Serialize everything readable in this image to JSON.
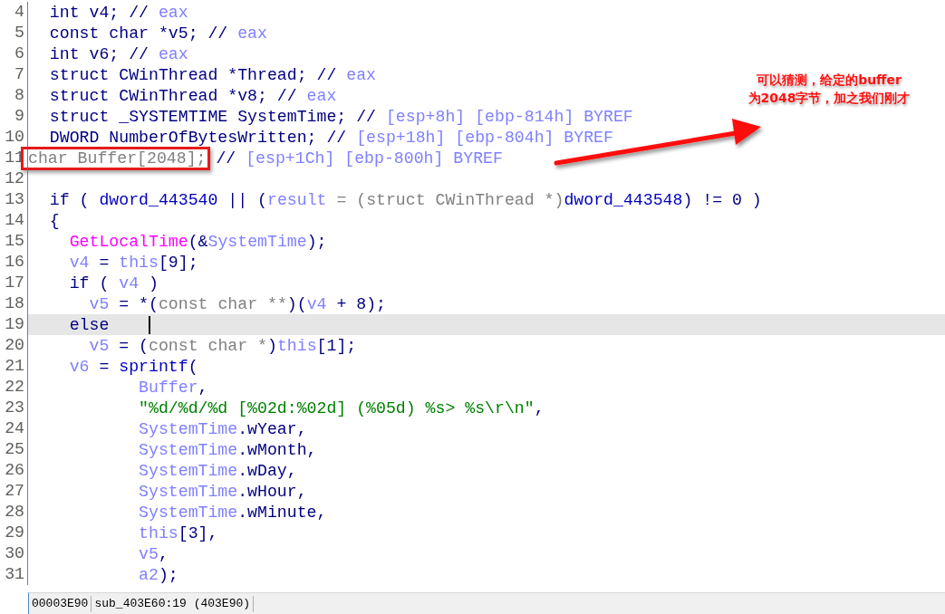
{
  "lines": [
    {
      "number": "4",
      "current": false,
      "parts": [
        {
          "text": "  int ",
          "kind": "k"
        },
        {
          "text": "v4",
          "kind": "k"
        },
        {
          "text": "; // ",
          "kind": "k"
        },
        {
          "text": "eax",
          "kind": "v"
        }
      ]
    },
    {
      "number": "5",
      "current": false,
      "parts": [
        {
          "text": "  const char *v5; // ",
          "kind": "k"
        },
        {
          "text": "eax",
          "kind": "v"
        }
      ]
    },
    {
      "number": "6",
      "current": false,
      "parts": [
        {
          "text": "  int v6; // ",
          "kind": "k"
        },
        {
          "text": "eax",
          "kind": "v"
        }
      ]
    },
    {
      "number": "7",
      "current": false,
      "parts": [
        {
          "text": "  struct CWinThread *Thread; // ",
          "kind": "k"
        },
        {
          "text": "eax",
          "kind": "v"
        }
      ]
    },
    {
      "number": "8",
      "current": false,
      "parts": [
        {
          "text": "  struct CWinThread *v8; // ",
          "kind": "k"
        },
        {
          "text": "eax",
          "kind": "v"
        }
      ]
    },
    {
      "number": "9",
      "current": false,
      "parts": [
        {
          "text": "  struct _SYSTEMTIME SystemTime; // ",
          "kind": "k"
        },
        {
          "text": "[esp+8h] [ebp-814h] BYREF",
          "kind": "v"
        }
      ]
    },
    {
      "number": "10",
      "current": false,
      "parts": [
        {
          "text": "  DWORD NumberOfBytesWritten; // ",
          "kind": "k"
        },
        {
          "text": "[esp+18h] [ebp-804h] BYREF",
          "kind": "v"
        }
      ]
    },
    {
      "number": "11",
      "current": false,
      "boxed": [
        {
          "text": "char Buffer[2048];",
          "kind": "g"
        }
      ],
      "parts": [
        {
          "text": " // ",
          "kind": "k"
        },
        {
          "text": "[esp+1Ch] [ebp-800h] BYREF",
          "kind": "v"
        }
      ]
    },
    {
      "number": "12",
      "current": false
    },
    {
      "number": "13",
      "current": false,
      "parts": [
        {
          "text": "  if ( ",
          "kind": "k"
        },
        {
          "text": "dword_443540",
          "kind": "b"
        },
        {
          "text": " || (",
          "kind": "k"
        },
        {
          "text": "result",
          "kind": "v"
        },
        {
          "text": " = (struct CWinThread *)",
          "kind": "g"
        },
        {
          "text": "dword_443548",
          "kind": "b"
        },
        {
          "text": ") != 0 )",
          "kind": "k"
        }
      ]
    },
    {
      "number": "14",
      "current": false,
      "parts": [
        {
          "text": "  {",
          "kind": "k"
        }
      ]
    },
    {
      "number": "15",
      "current": false,
      "parts": [
        {
          "text": "    GetLocalTime",
          "kind": "f"
        },
        {
          "text": "(&",
          "kind": "k"
        },
        {
          "text": "SystemTime",
          "kind": "v"
        },
        {
          "text": ");",
          "kind": "k"
        }
      ]
    },
    {
      "number": "16",
      "current": false,
      "parts": [
        {
          "text": "    v4",
          "kind": "v"
        },
        {
          "text": " = ",
          "kind": "k"
        },
        {
          "text": "this",
          "kind": "v"
        },
        {
          "text": "[9];",
          "kind": "k"
        }
      ]
    },
    {
      "number": "17",
      "current": false,
      "parts": [
        {
          "text": "    if ( ",
          "kind": "k"
        },
        {
          "text": "v4",
          "kind": "v"
        },
        {
          "text": " )",
          "kind": "k"
        }
      ]
    },
    {
      "number": "18",
      "current": false,
      "parts": [
        {
          "text": "      v5",
          "kind": "v"
        },
        {
          "text": " = *(",
          "kind": "k"
        },
        {
          "text": "const char **",
          "kind": "g"
        },
        {
          "text": ")(",
          "kind": "k"
        },
        {
          "text": "v4",
          "kind": "v"
        },
        {
          "text": " + 8);",
          "kind": "k"
        }
      ]
    },
    {
      "number": "19",
      "current": true,
      "parts": [
        {
          "text": "    else",
          "kind": "k"
        }
      ]
    },
    {
      "number": "20",
      "current": false,
      "parts": [
        {
          "text": "      v5",
          "kind": "v"
        },
        {
          "text": " = (",
          "kind": "k"
        },
        {
          "text": "const char *",
          "kind": "g"
        },
        {
          "text": ")",
          "kind": "k"
        },
        {
          "text": "this",
          "kind": "v"
        },
        {
          "text": "[1];",
          "kind": "k"
        }
      ]
    },
    {
      "number": "21",
      "current": false,
      "parts": [
        {
          "text": "    v6",
          "kind": "v"
        },
        {
          "text": " = ",
          "kind": "k"
        },
        {
          "text": "sprintf",
          "kind": "b"
        },
        {
          "text": "(",
          "kind": "k"
        }
      ]
    },
    {
      "number": "22",
      "current": false,
      "parts": [
        {
          "text": "           Buffer",
          "kind": "v"
        },
        {
          "text": ",",
          "kind": "k"
        }
      ]
    },
    {
      "number": "23",
      "current": false,
      "parts": [
        {
          "text": "           \"%d/%d/%d [%02d:%02d] (%05d) %s> %s\\r\\n\"",
          "kind": "s"
        },
        {
          "text": ",",
          "kind": "k"
        }
      ]
    },
    {
      "number": "24",
      "current": false,
      "parts": [
        {
          "text": "           SystemTime",
          "kind": "v"
        },
        {
          "text": ".wYear,",
          "kind": "k"
        }
      ]
    },
    {
      "number": "25",
      "current": false,
      "parts": [
        {
          "text": "           SystemTime",
          "kind": "v"
        },
        {
          "text": ".wMonth,",
          "kind": "k"
        }
      ]
    },
    {
      "number": "26",
      "current": false,
      "parts": [
        {
          "text": "           SystemTime",
          "kind": "v"
        },
        {
          "text": ".wDay,",
          "kind": "k"
        }
      ]
    },
    {
      "number": "27",
      "current": false,
      "parts": [
        {
          "text": "           SystemTime",
          "kind": "v"
        },
        {
          "text": ".wHour,",
          "kind": "k"
        }
      ]
    },
    {
      "number": "28",
      "current": false,
      "parts": [
        {
          "text": "           SystemTime",
          "kind": "v"
        },
        {
          "text": ".wMinute,",
          "kind": "k"
        }
      ]
    },
    {
      "number": "29",
      "current": false,
      "parts": [
        {
          "text": "           this",
          "kind": "v"
        },
        {
          "text": "[3],",
          "kind": "k"
        }
      ]
    },
    {
      "number": "30",
      "current": false,
      "parts": [
        {
          "text": "           v5",
          "kind": "v"
        },
        {
          "text": ",",
          "kind": "k"
        }
      ]
    },
    {
      "number": "31",
      "current": false,
      "parts": [
        {
          "text": "           a2",
          "kind": "v"
        },
        {
          "text": ");",
          "kind": "k"
        }
      ]
    }
  ],
  "annotation": {
    "lines": [
      "可以猜测，给定的buffer",
      "为2048字节，加之我们刚才"
    ]
  },
  "status_bar": [
    "00003E90",
    "sub_403E60:19 (403E90)"
  ]
}
